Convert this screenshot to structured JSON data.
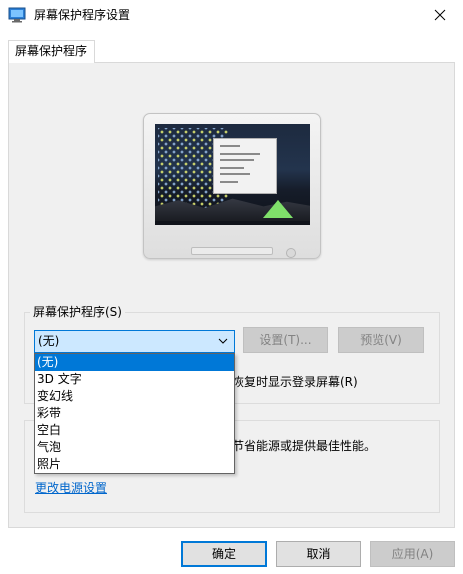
{
  "window": {
    "title": "屏幕保护程序设置",
    "icon": "screensaver-settings-icon",
    "close_icon": "close-icon"
  },
  "tab": {
    "label": "屏幕保护程序"
  },
  "screensaver": {
    "group_label": "屏幕保护程序(S)",
    "selected": "(无)",
    "options": [
      "(无)",
      "3D 文字",
      "变幻线",
      "彩带",
      "空白",
      "气泡",
      "照片"
    ],
    "settings_label": "设置(T)...",
    "preview_label": "预览(V)",
    "resume_text": "恢复时显示登录屏幕(R)"
  },
  "power": {
    "text": "节省能源或提供最佳性能。",
    "link_label": "更改电源设置"
  },
  "buttons": {
    "ok": "确定",
    "cancel": "取消",
    "apply": "应用(A)"
  },
  "colors": {
    "accent": "#0078d7",
    "selection_bg": "#cce8ff",
    "link": "#0066cc"
  }
}
